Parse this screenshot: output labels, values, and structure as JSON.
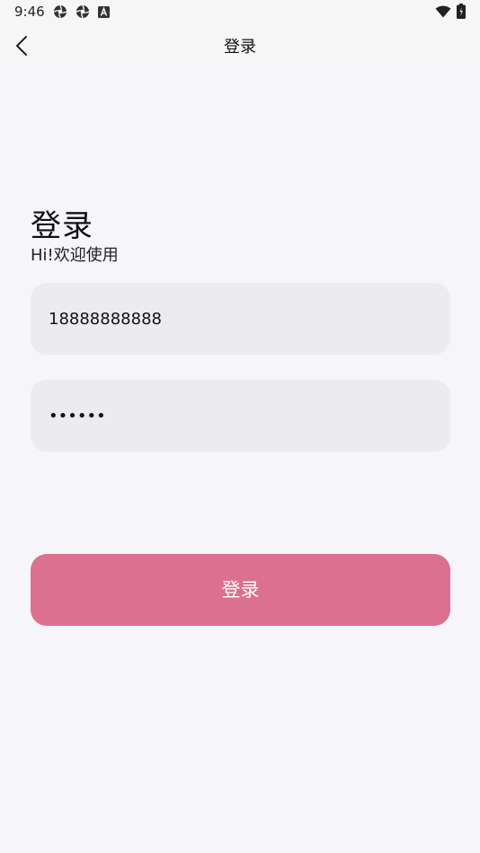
{
  "status_bar": {
    "time": "9:46",
    "icons": [
      "aperture-icon",
      "aperture-icon",
      "font-a-icon",
      "wifi-icon",
      "battery-icon"
    ]
  },
  "nav": {
    "back_icon": "chevron-left-icon",
    "title": "登录"
  },
  "heading": {
    "title": "登录",
    "subtitle": "Hi!欢迎使用"
  },
  "form": {
    "phone_value": "18888888888",
    "password_value": "123456"
  },
  "login_button_label": "登录",
  "colors": {
    "background": "#f6f5fa",
    "field_background": "#ecebf0",
    "button_background": "#dc7090",
    "button_text": "#ffffff"
  }
}
